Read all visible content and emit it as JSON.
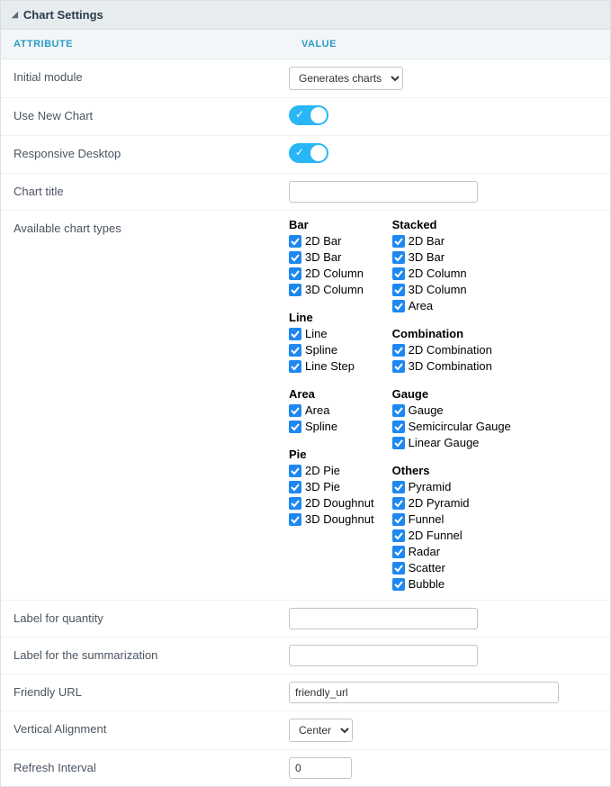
{
  "panel": {
    "title": "Chart Settings"
  },
  "columns": {
    "attr": "ATTRIBUTE",
    "val": "VALUE"
  },
  "rows": {
    "initial_module": {
      "label": "Initial module",
      "selected": "Generates charts"
    },
    "use_new_chart": {
      "label": "Use New Chart"
    },
    "responsive_desktop": {
      "label": "Responsive Desktop"
    },
    "chart_title": {
      "label": "Chart title",
      "value": ""
    },
    "available_types": {
      "label": "Available chart types"
    },
    "label_quantity": {
      "label": "Label for quantity",
      "value": ""
    },
    "label_summarization": {
      "label": "Label for the summarization",
      "value": ""
    },
    "friendly_url": {
      "label": "Friendly URL",
      "value": "friendly_url"
    },
    "vertical_alignment": {
      "label": "Vertical Alignment",
      "selected": "Center"
    },
    "refresh_interval": {
      "label": "Refresh Interval",
      "value": "0"
    }
  },
  "chart_types": {
    "left": [
      {
        "title": "Bar",
        "opts": [
          "2D Bar",
          "3D Bar",
          "2D Column",
          "3D Column"
        ]
      },
      {
        "title": "Line",
        "opts": [
          "Line",
          "Spline",
          "Line Step"
        ]
      },
      {
        "title": "Area",
        "opts": [
          "Area",
          "Spline"
        ]
      },
      {
        "title": "Pie",
        "opts": [
          "2D Pie",
          "3D Pie",
          "2D Doughnut",
          "3D Doughnut"
        ]
      }
    ],
    "right": [
      {
        "title": "Stacked",
        "opts": [
          "2D Bar",
          "3D Bar",
          "2D Column",
          "3D Column",
          "Area"
        ]
      },
      {
        "title": "Combination",
        "opts": [
          "2D Combination",
          "3D Combination"
        ]
      },
      {
        "title": "Gauge",
        "opts": [
          "Gauge",
          "Semicircular Gauge",
          "Linear Gauge"
        ]
      },
      {
        "title": "Others",
        "opts": [
          "Pyramid",
          "2D Pyramid",
          "Funnel",
          "2D Funnel",
          "Radar",
          "Scatter",
          "Bubble"
        ]
      }
    ]
  }
}
